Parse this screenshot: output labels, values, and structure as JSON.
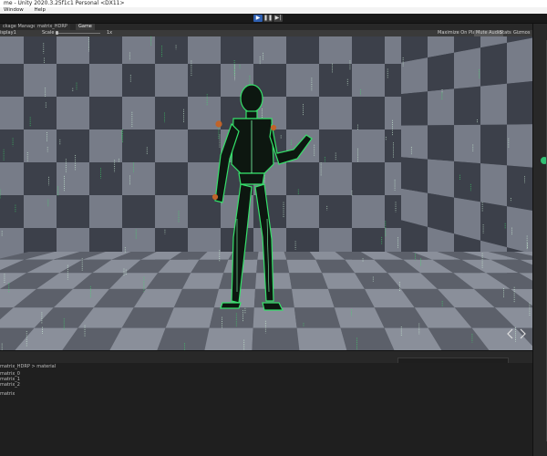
{
  "window": {
    "title": "me - Unity 2020.3.25f1c1 Personal <DX11>"
  },
  "menu": {
    "items": [
      "Window",
      "Help"
    ]
  },
  "toolbar": {
    "play_icon": "play-icon",
    "pause_icon": "pause-icon",
    "step_icon": "step-icon",
    "play_active_color": "#2e5fb1"
  },
  "tabs": [
    {
      "label": "ckage Manager"
    },
    {
      "label": "matrix_HDRP"
    },
    {
      "label": "Game"
    }
  ],
  "game_toolbar": {
    "aspect": "isplay1",
    "scale_label": "Scale",
    "zoom": "1x",
    "maximize": "Maximize On Play",
    "mute": "Mute Audio",
    "stats": "Stats",
    "gizmos": "Gizmos"
  },
  "project": {
    "breadcrumb": "matrix_HDRP > material",
    "assets": [
      "matrix_0",
      "matrix_1",
      "matrix_2",
      "matrix"
    ]
  },
  "colors": {
    "accent_green": "#2fbf73",
    "matrix_green": "#39e36b",
    "floor_dark": "#3c404a",
    "floor_light": "#777c88"
  }
}
